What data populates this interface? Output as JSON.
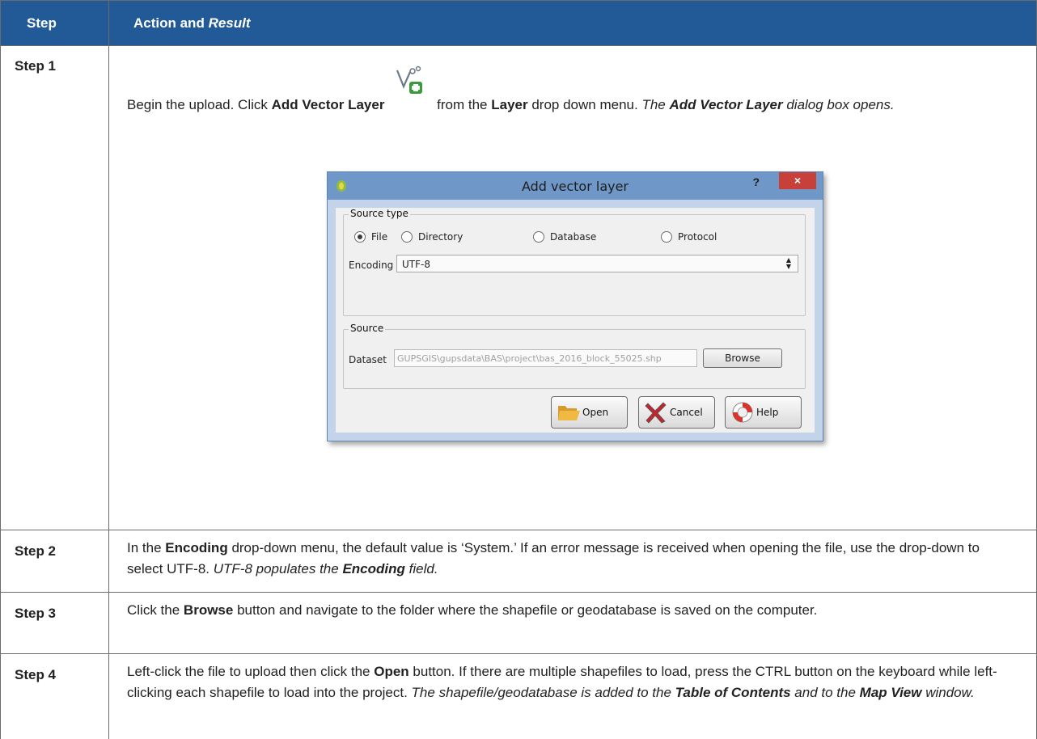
{
  "table": {
    "header": {
      "step": "Step",
      "action": "Action and ",
      "result": "Result"
    },
    "rows": [
      {
        "step": "Step 1",
        "p1": "Begin the upload. Click ",
        "p1_b": "Add Vector Layer",
        "p1_mid": " from the ",
        "p1_b2": "Layer",
        "p1_end": " drop down menu. ",
        "p1_i1": "The ",
        "p1_ib": "Add Vector Layer",
        "p1_i2": " dialog box opens."
      },
      {
        "step": "Step 2",
        "t1": "In the ",
        "b1": "Encoding",
        "t2": " drop-down menu, the default value is ‘System.’ If an error message is received when opening the file, use the drop-down to select UTF-8. ",
        "i1": "UTF-8 populates the ",
        "ib": "Encoding",
        "i2": " field."
      },
      {
        "step": "Step 3",
        "t1": "Click the ",
        "b1": "Browse",
        "t2": " button and navigate to the folder where the shapefile or geodatabase is saved on the computer."
      },
      {
        "step": "Step 4",
        "t1": "Left-click the file to upload then click the ",
        "b1": "Open",
        "t2": " button. If there are multiple shapefiles to load, press the CTRL button on the keyboard while left-clicking each shapefile to load into the project. ",
        "i1": "The shapefile/geodatabase is added to the ",
        "ib1": "Table of Contents",
        "i2": " and to the ",
        "ib2": "Map View",
        "i3": " window."
      }
    ]
  },
  "dialog": {
    "title": "Add vector layer",
    "help_mark": "?",
    "close_mark": "×",
    "source_type_label": "Source type",
    "radios": [
      "File",
      "Directory",
      "Database",
      "Protocol"
    ],
    "selected_radio": "File",
    "encoding_label": "Encoding",
    "encoding_value": "UTF-8",
    "source_label": "Source",
    "dataset_label": "Dataset",
    "dataset_value": "GUPSGIS\\gupsdata\\BAS\\project\\bas_2016_block_55025.shp",
    "browse_label": "Browse",
    "open_label": "Open",
    "cancel_label": "Cancel",
    "help_label": "Help"
  },
  "colors": {
    "header_bg": "#215a96",
    "dialog_title_bg": "#6f98c8",
    "close_bg": "#c7413a"
  },
  "icons": [
    "add-vector-layer-icon",
    "qgis-logo-icon",
    "folder-open-icon",
    "cancel-x-icon",
    "help-lifebuoy-icon"
  ]
}
